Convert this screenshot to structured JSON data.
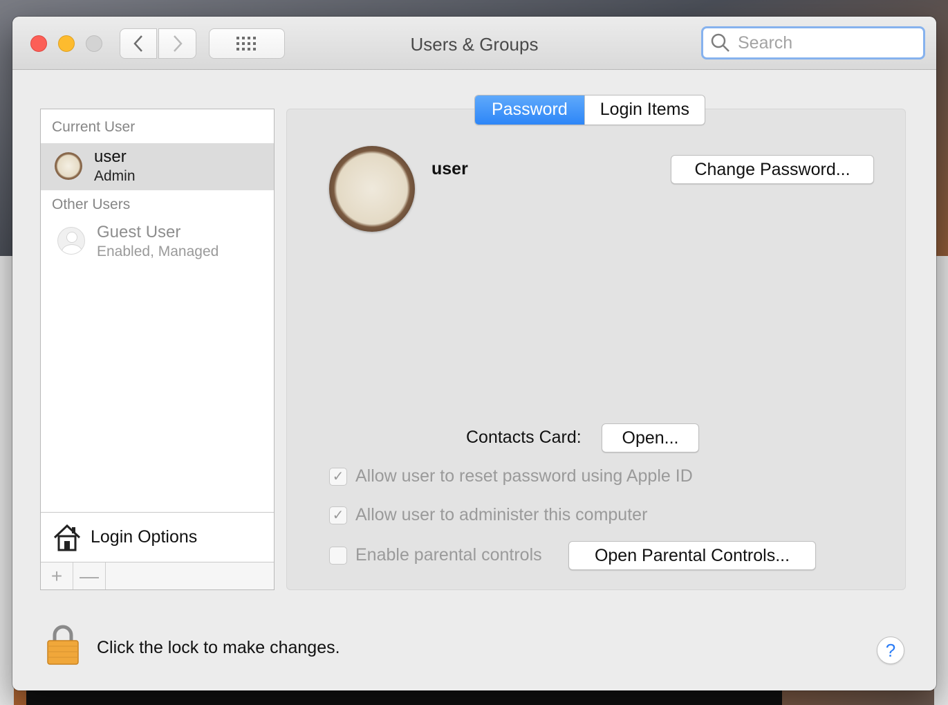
{
  "window": {
    "title": "Users & Groups"
  },
  "toolbar": {
    "back_icon": "chevron-left-icon",
    "forward_icon": "chevron-right-icon",
    "show_all_icon": "grid-icon",
    "search_placeholder": "Search"
  },
  "sidebar": {
    "current_header": "Current User",
    "current_user": {
      "name": "user",
      "role": "Admin"
    },
    "other_header": "Other Users",
    "guest_user": {
      "name": "Guest User",
      "status": "Enabled, Managed"
    },
    "login_options_label": "Login Options",
    "add_label": "+",
    "remove_label": "—"
  },
  "tabs": [
    {
      "label": "Password",
      "active": true
    },
    {
      "label": "Login Items",
      "active": false
    }
  ],
  "detail": {
    "username": "user",
    "change_password_label": "Change Password...",
    "contacts_card_label": "Contacts Card:",
    "open_label": "Open...",
    "options": [
      {
        "label": "Allow user to reset password using Apple ID",
        "checked": true
      },
      {
        "label": "Allow user to administer this computer",
        "checked": true
      },
      {
        "label": "Enable parental controls",
        "checked": false
      }
    ],
    "open_parental_label": "Open Parental Controls..."
  },
  "footer": {
    "lock_text": "Click the lock to make changes.",
    "help_label": "?"
  },
  "colors": {
    "accent": "#2d86f7",
    "close": "#fc5f57",
    "minimize": "#fdbb2e",
    "lock": "#f0a73a"
  }
}
